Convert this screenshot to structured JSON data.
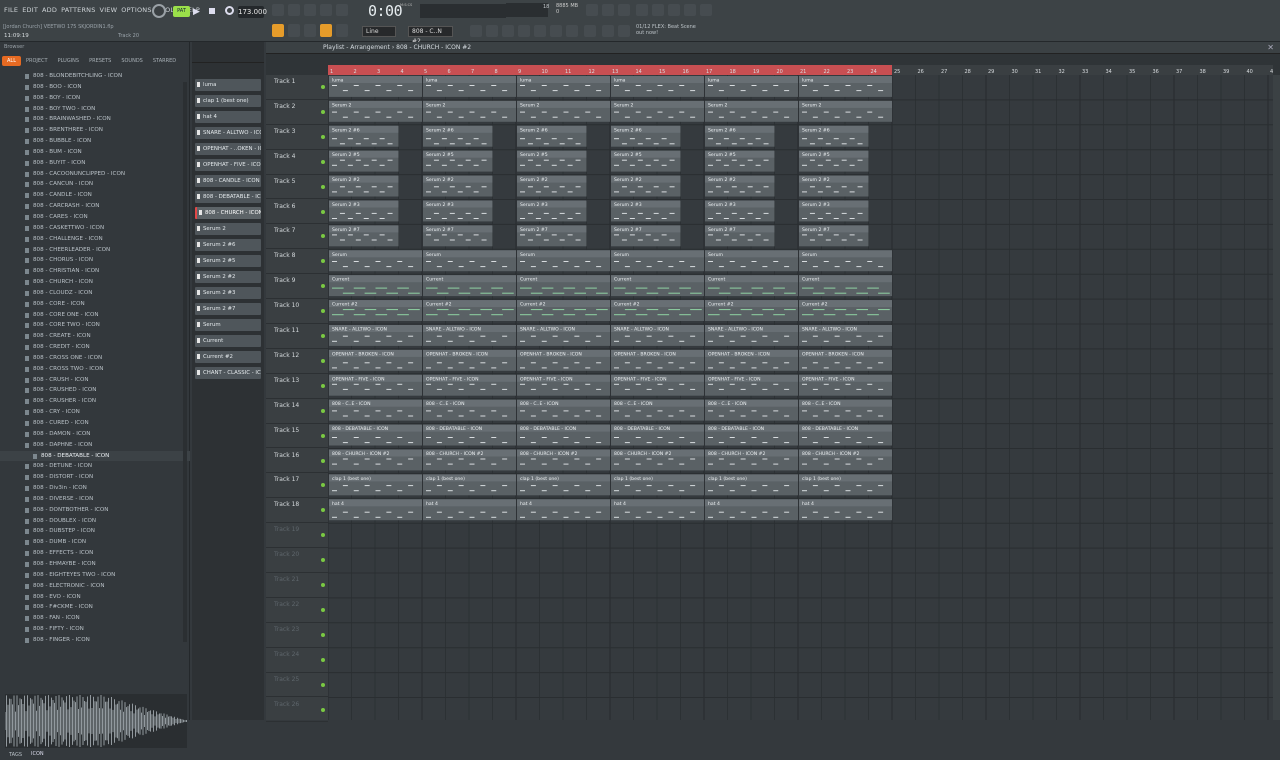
{
  "menu": [
    "FILE",
    "EDIT",
    "ADD",
    "PATTERNS",
    "VIEW",
    "OPTIONS",
    "TOOLS",
    "HELP"
  ],
  "song": {
    "hint": "[Jordan Church] VEETWO 175 SKJORDIN1.flp",
    "time": "11:09:19",
    "track": "Track 20"
  },
  "transport": {
    "pattern_mode": "PAT",
    "tempo": "173.000",
    "time_display": "0:00",
    "time_unit": "M:S:CS",
    "cpu": "18",
    "ram": "8885 MB",
    "voices": "0"
  },
  "hint_panel": {
    "line1": "01/12  FLEX: Beat Scene",
    "line2": "out now!"
  },
  "toolbar": {
    "snap": "Line",
    "pattern": "808 - C..N #2"
  },
  "browser": {
    "title": "Browser",
    "tabs": [
      "ALL",
      "PROJECT",
      "PLUGINS",
      "PRESETS",
      "SOUNDS",
      "STARRED"
    ],
    "selected_folder": "808 - DEBATABLE - ICON",
    "items": [
      "808 - BLONDEBITCHLING - ICON",
      "808 - BOO - ICON",
      "808 - BOY - ICON",
      "808 - BOY TWO - ICON",
      "808 - BRAINWASHED - ICON",
      "808 - BRENTHREE - ICON",
      "808 - BUBBLE - ICON",
      "808 - BUM - ICON",
      "808 - BUYIT - ICON",
      "808 - CACOONUNCLIPPED - ICON",
      "808 - CANCUN - ICON",
      "808 - CANDLE - ICON",
      "808 - CARCRASH - ICON",
      "808 - CARES - ICON",
      "808 - CASKETTWO - ICON",
      "808 - CHALLENGE - ICON",
      "808 - CHEERLEADER - ICON",
      "808 - CHORUS - ICON",
      "808 - CHRISTIAN - ICON",
      "808 - CHURCH - ICON",
      "808 - CLOUDZ - ICON",
      "808 - CORE - ICON",
      "808 - CORE ONE - ICON",
      "808 - CORE TWO - ICON",
      "808 - CREATE - ICON",
      "808 - CREDIT - ICON",
      "808 - CROSS ONE - ICON",
      "808 - CROSS TWO - ICON",
      "808 - CRUSH - ICON",
      "808 - CRUSHED - ICON",
      "808 - CRUSHER - ICON",
      "808 - CRY - ICON",
      "808 - CURED - ICON",
      "808 - DAMON - ICON",
      "808 - DAPHNE - ICON",
      "808 - DEBATABLE - ICON",
      "808 - DETUNE - ICON",
      "808 - DISTORT - ICON",
      "808 - Div3in - ICON",
      "808 - DIVERSE - ICON",
      "808 - DONTBOTHER - ICON",
      "808 - DOUBLEX - ICON",
      "808 - DUBSTEP - ICON",
      "808 - DUMB - ICON",
      "808 - EFFECTS - ICON",
      "808 - EHMAYBE - ICON",
      "808 - EIGHTEYES TWO - ICON",
      "808 - ELECTRONIC - ICON",
      "808 - EVO - ICON",
      "808 - F#CKME - ICON",
      "808 - FAN - ICON",
      "808 - FIFTY - ICON",
      "808 - FINGER - ICON"
    ],
    "tags_label": "TAGS",
    "tags_value": "ICON"
  },
  "picker": [
    "luma",
    "clap 1 (best one)",
    "hat 4",
    "SNARE - ALLTWO - ICON",
    "OPENHAT - ..OKEN - ICON",
    "OPENHAT - FIVE - ICON",
    "808 - CANDLE - ICON",
    "808 - DEBATABLE - ICON",
    "808 - CHURCH - ICON #2",
    "Serum 2",
    "Serum 2 #6",
    "Serum 2 #5",
    "Serum 2 #2",
    "Serum 2 #3",
    "Serum 2 #7",
    "Serum",
    "Current",
    "Current #2",
    "CHANT - CLASSIC - ICON"
  ],
  "picker_selected": 8,
  "playlist": {
    "title": "Playlist - Arrangement › 808 - CHURCH - ICON #2",
    "bars_filled": 24,
    "bars_total": 50,
    "tracks": [
      {
        "name": "Track 1",
        "clip": "luma"
      },
      {
        "name": "Track 2",
        "clip": "Serum 2"
      },
      {
        "name": "Track 3",
        "clip": "Serum 2 #6"
      },
      {
        "name": "Track 4",
        "clip": "Serum 2 #5"
      },
      {
        "name": "Track 5",
        "clip": "Serum 2 #2"
      },
      {
        "name": "Track 6",
        "clip": "Serum 2 #3"
      },
      {
        "name": "Track 7",
        "clip": "Serum 2 #7"
      },
      {
        "name": "Track 8",
        "clip": "Serum"
      },
      {
        "name": "Track 9",
        "clip": "Current"
      },
      {
        "name": "Track 10",
        "clip": "Current #2"
      },
      {
        "name": "Track 11",
        "clip": "SNARE - ALLTWO - ICON"
      },
      {
        "name": "Track 12",
        "clip": "OPENHAT - BROKEN - ICON"
      },
      {
        "name": "Track 13",
        "clip": "OPENHAT - FIVE - ICON"
      },
      {
        "name": "Track 14",
        "clip": "808 - C..E - ICON"
      },
      {
        "name": "Track 15",
        "clip": "808 - DEBATABLE - ICON"
      },
      {
        "name": "Track 16",
        "clip": "808 - CHURCH - ICON #2"
      },
      {
        "name": "Track 17",
        "clip": "clap 1 (best one)"
      },
      {
        "name": "Track 18",
        "clip": "hat 4"
      },
      {
        "name": "Track 19",
        "clip": ""
      },
      {
        "name": "Track 20",
        "clip": ""
      },
      {
        "name": "Track 21",
        "clip": ""
      },
      {
        "name": "Track 22",
        "clip": ""
      },
      {
        "name": "Track 23",
        "clip": ""
      },
      {
        "name": "Track 24",
        "clip": ""
      },
      {
        "name": "Track 25",
        "clip": ""
      },
      {
        "name": "Track 26",
        "clip": ""
      }
    ]
  },
  "colors": {
    "accent": "#e66a22",
    "clip": "#5a6165",
    "ruler_active": "#c84f52",
    "led": "#7ac943"
  }
}
